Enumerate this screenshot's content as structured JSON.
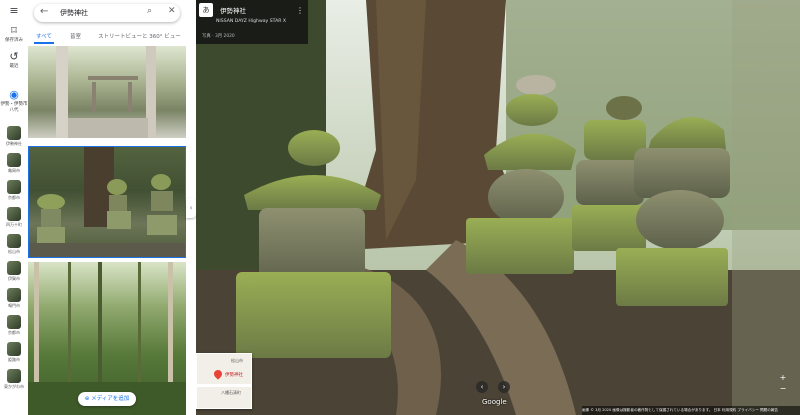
{
  "rail": {
    "items": [
      {
        "icon": "menu-icon",
        "label": ""
      },
      {
        "icon": "bookmark-icon",
        "label": "保存済み"
      },
      {
        "icon": "history-icon",
        "label": "最近"
      }
    ],
    "places": [
      {
        "label": "伊勢神社"
      },
      {
        "label": "亀岡市"
      },
      {
        "label": "京都市"
      },
      {
        "label": "四万十町"
      },
      {
        "label": "松山市"
      },
      {
        "label": "伊賀市"
      },
      {
        "label": "鳴門市"
      },
      {
        "label": "京都市"
      },
      {
        "label": "姫路市"
      },
      {
        "label": "東かがわ市"
      }
    ],
    "recent_label": "伊勢・伊勢市 八代"
  },
  "search": {
    "query": "伊勢神社"
  },
  "tabs": [
    {
      "label": "すべて",
      "active": true
    },
    {
      "label": "皆室",
      "active": false
    },
    {
      "label": "ストリートビューと 360° ビュー",
      "active": false
    }
  ],
  "panel": {
    "add_media_label": "メディアを追加"
  },
  "infocard": {
    "badge": "あ",
    "title": "伊勢神社",
    "subtitle": "NISSAN DAYZ Highway STAR X",
    "date": "写真 · 3月 2020"
  },
  "minimap": {
    "place": "伊勢神社",
    "area": "松山市",
    "road": "八幡石清町"
  },
  "brand": "Google",
  "footer": "画像 ©︎ 3月 2020   画像は撮影者の著作物として保護されている場合があります。   日本   利用規約   プライバシー   問題の報告",
  "colors": {
    "accent": "#1a73e8",
    "pin": "#ea4335"
  }
}
